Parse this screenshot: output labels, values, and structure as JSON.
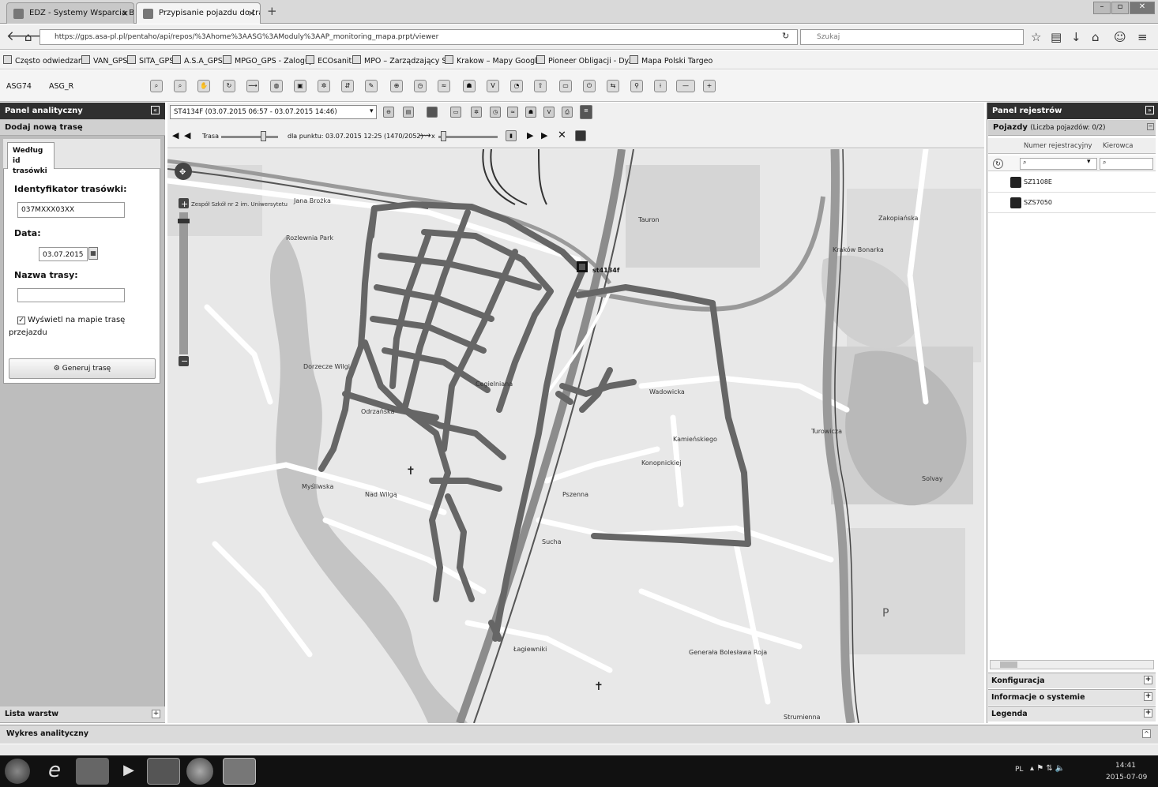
{
  "browser": {
    "tabs": [
      {
        "title": "EDZ - Systemy Wsparcia Bi..."
      },
      {
        "title": "Przypisanie pojazdu do tras..."
      }
    ],
    "url": "https://gps.asa-pl.pl/pentaho/api/repos/%3Ahome%3AASG%3AModuly%3AAP_monitoring_mapa.prpt/viewer",
    "search_placeholder": "Szukaj",
    "bookmarks": [
      "Często odwiedzane",
      "VAN_GPS",
      "SITA_GPS",
      "A.S.A_GPS",
      "MPGO_GPS - Zaloguj",
      "ECOsanit",
      "MPO – Zarządzający S...",
      "Krakow – Mapy Google",
      "Pioneer Obligacji - Dy...",
      "Mapa Polski Targeo"
    ]
  },
  "app_toolbar": {
    "user_labels": [
      "ASG74",
      "ASG_R"
    ]
  },
  "left_panel": {
    "title": "Panel analityczny",
    "section": "Dodaj nową trasę",
    "tab_label_line1": "Według",
    "tab_label_line2": "id trasówki",
    "id_label": "Identyfikator trasówki:",
    "id_value": "037MXXX03XX",
    "date_label": "Data:",
    "date_value": "03.07.2015",
    "route_name_label": "Nazwa trasy:",
    "route_name_value": "",
    "checkbox_label_1": "Wyświetl na mapie trasę",
    "checkbox_label_2": "przejazdu",
    "generate_button": "Generuj trasę",
    "layers_label": "Lista warstw"
  },
  "map_toolbar": {
    "vehicle_select": "ST4134F (03.07.2015 06:57 - 03.07.2015 14:46)",
    "route_label": "Trasa",
    "point_label": "dla punktu: 03.07.2015 12:25 (1470/2052)",
    "zoom_label": "x"
  },
  "map": {
    "vehicle_marker": "st4134f",
    "labels": [
      "Tauron",
      "Kraków Bonarka",
      "Dorzecze Wilgi",
      "Rozlewnia Park",
      "Zespół Szkół nr 2 im. Uniwersytetu",
      "Jana Brożka",
      "Łagiewniki",
      "Wadowicka",
      "Sucha",
      "Pszenna",
      "Konopnickiej",
      "Kamieńskiego",
      "Turowicza",
      "Nad Wilgą",
      "Odrzańska",
      "Zakopiańska",
      "Solvay",
      "Generała Bolesława Roja",
      "Cegielniana",
      "Strumienna",
      "Myśliwska"
    ]
  },
  "right_panel": {
    "title": "Panel rejestrów",
    "section": "Pojazdy",
    "section_count": "(Liczba pojazdów: 0/2)",
    "columns": [
      "Numer rejestracyjny",
      "Kierowca"
    ],
    "vehicles": [
      {
        "plate": "SZ1108E",
        "driver": ""
      },
      {
        "plate": "SZS7050",
        "driver": ""
      }
    ],
    "accordion": [
      "Konfiguracja",
      "Informacje o systemie",
      "Legenda"
    ]
  },
  "bottom_panel": {
    "title": "Wykres analityczny"
  },
  "taskbar": {
    "lang": "PL",
    "time": "14:41",
    "date": "2015-07-09"
  }
}
